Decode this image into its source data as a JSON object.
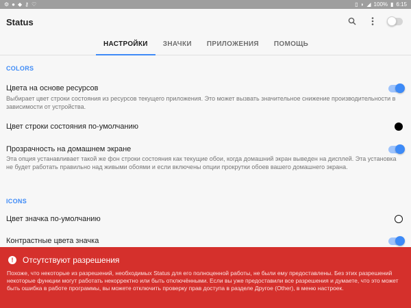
{
  "status_bar": {
    "left_icons": [
      "settings-cog-icon",
      "drop-icon",
      "shield-icon",
      "key-icon",
      "heart-check-icon"
    ],
    "right_icons": [
      "vibrate-icon",
      "wifi-icon",
      "signal-icon"
    ],
    "battery": "100%",
    "time": "6:15"
  },
  "appbar": {
    "title": "Status",
    "master_switch_on": false
  },
  "tabs": [
    {
      "label": "НАСТРОЙКИ",
      "active": true
    },
    {
      "label": "ЗНАЧКИ",
      "active": false
    },
    {
      "label": "ПРИЛОЖЕНИЯ",
      "active": false
    },
    {
      "label": "ПОМОЩЬ",
      "active": false
    }
  ],
  "sections": {
    "colors": "COLORS",
    "icons": "ICONS"
  },
  "settings": [
    {
      "title": "Цвета на основе ресурсов",
      "description": "Выбирает цвет строки состояния из ресурсов текущего приложения. Это может вызвать значительное снижение производительности в зависимости от устройства.",
      "control": "toggle",
      "enabled": true
    },
    {
      "title": "Цвет строки состояния по-умолчанию",
      "control": "color",
      "color": "#000000"
    },
    {
      "title": "Прозрачность на домашнем экране",
      "description": "Эта опция устанавливает такой же фон строки состояния как текущие обои, когда домашний экран выведен на дисплей. Эта установка не будет работать правильно над живыми обоями и если включены опции прокрутки обоев вашего домашнего экрана.",
      "control": "toggle",
      "enabled": true
    },
    {
      "title": "Цвет значка по-умолчанию",
      "control": "color",
      "color": "#ffffff"
    },
    {
      "title": "Контрастные цвета значка",
      "control": "toggle",
      "enabled": true
    }
  ],
  "banner": {
    "title": "Отсутствуют разрешения",
    "text": "Похоже, что некоторые из разрешений, необходимых Status для его полноценной работы, не были ему предоставлены. Без этих разрешений некоторые функции могут работать некорректно или быть отключёнными. Если вы уже предоставили все разрешения и думаете, что это может быть ошибка в работе программы, вы можете отключить проверку прав доступа в разделе Другое (Other), в меню настроек.",
    "color": "#d5302c"
  },
  "colors": {
    "accent": "#3d8af7",
    "toggle_track": "#9ec3fb"
  }
}
